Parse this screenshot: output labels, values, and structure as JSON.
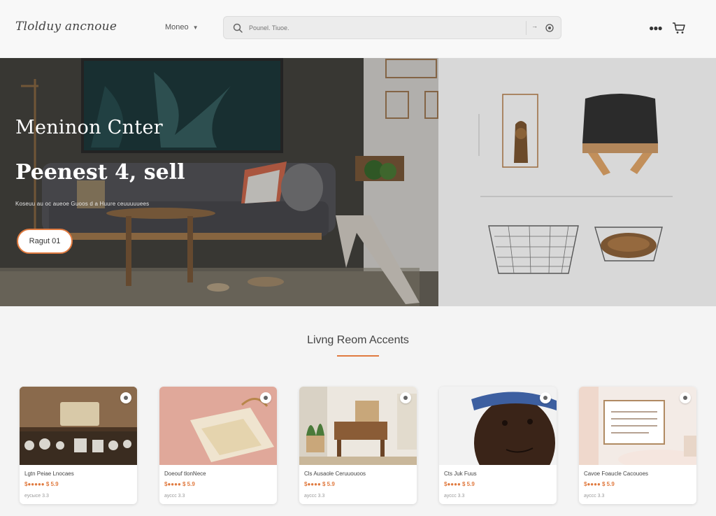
{
  "header": {
    "logo": "Tlolduy ancnoue",
    "nav_label": "Moneo",
    "search_placeholder": "Pounel. Tiuoe.",
    "mic_label": "→"
  },
  "hero": {
    "title": "Meninon Cnter",
    "subtitle": "Peenest 4, sell",
    "description": "Koseuu au oc aueoe Guoos d a Huure ceuuuuuees",
    "button_label": "Ragut 01"
  },
  "section": {
    "title": "Livng Reom Accents"
  },
  "products": [
    {
      "name": "Lgtn Peiae Lnocaes",
      "price": "$●●●●● $ 5.9",
      "meta": "еусысе 3.3"
    },
    {
      "name": "Doeouf tlonNece",
      "price": "$●●●● $ 5.9",
      "meta": "ауссс 3.3"
    },
    {
      "name": "Cls Ausaole Ceruuouoos",
      "price": "$●●●● $ 5.9",
      "meta": "ауссс 3.3"
    },
    {
      "name": "Cts Juk Fuus",
      "price": "$●●●● $ 5.9",
      "meta": "ауссс 3.3"
    },
    {
      "name": "Cavoe Foaucle Cacouoes",
      "price": "$●●●● $ 5.9",
      "meta": "ауссс 3.3"
    }
  ],
  "colors": {
    "accent": "#e07a3f",
    "hero_dark": "#3a3a38",
    "hero_light": "#d6d6d6"
  },
  "icons": [
    "search-icon",
    "camera-icon",
    "more-icon",
    "cart-icon",
    "favorite-icon",
    "chevron-down-icon"
  ]
}
